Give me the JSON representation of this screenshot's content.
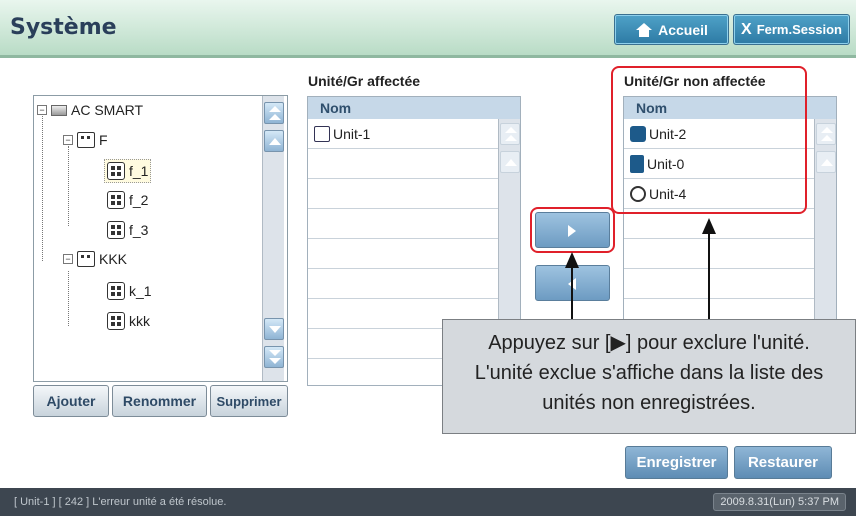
{
  "header": {
    "title": "Système",
    "home_label": "Accueil",
    "logout_label": "Ferm.Session"
  },
  "tree": {
    "items": [
      {
        "label": "AC SMART"
      },
      {
        "label": "F"
      },
      {
        "label": "f_1"
      },
      {
        "label": "f_2"
      },
      {
        "label": "f_3"
      },
      {
        "label": "KKK"
      },
      {
        "label": "k_1"
      },
      {
        "label": "kkk"
      }
    ],
    "buttons": {
      "add": "Ajouter",
      "rename": "Renommer",
      "delete": "Supprimer"
    }
  },
  "assigned": {
    "title": "Unité/Gr affectée",
    "column": "Nom",
    "rows": [
      "Unit-1"
    ]
  },
  "unassigned": {
    "title": "Unité/Gr non affectée",
    "column": "Nom",
    "rows": [
      "Unit-2",
      "Unit-0",
      "Unit-4"
    ]
  },
  "actions": {
    "save": "Enregistrer",
    "restore": "Restaurer"
  },
  "callout": {
    "line1": "Appuyez sur [▶] pour exclure l'unité.",
    "line2": "L'unité exclue s'affiche dans la liste des",
    "line3": "unités non enregistrées."
  },
  "status": {
    "message": "[ Unit-1 ] [ 242 ] L'erreur unité a été résolue.",
    "datetime": "2009.8.31(Lun)  5:37 PM"
  }
}
